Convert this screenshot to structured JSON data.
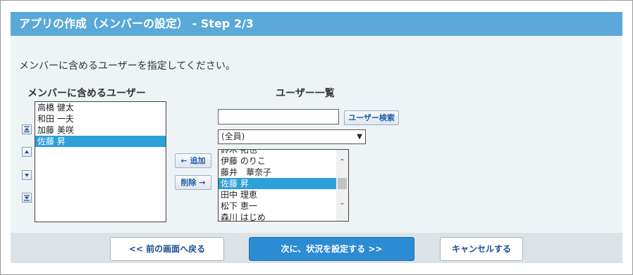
{
  "title": "アプリの作成（メンバーの設定） - Step 2/3",
  "instruction": "メンバーに含めるユーザーを指定してください。",
  "members": {
    "heading": "メンバーに含めるユーザー",
    "items": [
      {
        "label": "高橋 健太",
        "selected": false
      },
      {
        "label": "和田 一夫",
        "selected": false
      },
      {
        "label": "加藤 美咲",
        "selected": false
      },
      {
        "label": "佐藤 昇",
        "selected": true
      }
    ],
    "order_icons": [
      "move-top-icon",
      "move-up-icon",
      "move-down-icon",
      "move-bottom-icon"
    ]
  },
  "actions": {
    "add_label": "← 追加",
    "remove_label": "削除 →"
  },
  "users": {
    "heading": "ユーザー一覧",
    "search_value": "",
    "search_button": "ユーザー検索",
    "group_select": "(全員)",
    "items": [
      {
        "label": "鈴木 拓也",
        "selected": false
      },
      {
        "label": "伊藤 のりこ",
        "selected": false
      },
      {
        "label": "藤井　華奈子",
        "selected": false
      },
      {
        "label": "佐藤 昇",
        "selected": true
      },
      {
        "label": "田中 理恵",
        "selected": false
      },
      {
        "label": "松下 恵一",
        "selected": false
      },
      {
        "label": "森川 はじめ",
        "selected": false
      }
    ]
  },
  "footer": {
    "back": "<< 前の画面へ戻る",
    "next": "次に、状況を設定する >>",
    "cancel": "キャンセルする"
  },
  "colors": {
    "titlebar": "#5aa9d8",
    "selection": "#2e9fd8",
    "primary_button": "#2b8bd3"
  }
}
